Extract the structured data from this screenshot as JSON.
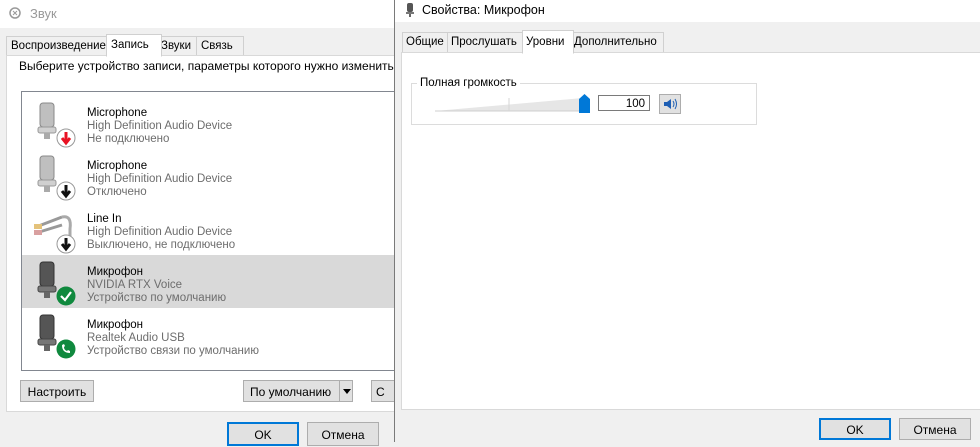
{
  "sound_window": {
    "title": "Звук",
    "tabs": [
      "Воспроизведение",
      "Запись",
      "Звуки",
      "Связь"
    ],
    "active_tab": "Запись",
    "instruction": "Выберите устройство записи, параметры которого нужно изменить:",
    "devices": [
      {
        "name": "Microphone",
        "driver": "High Definition Audio Device",
        "status": "Не подключено",
        "badge": "arrow-down-red-icon"
      },
      {
        "name": "Microphone",
        "driver": "High Definition Audio Device",
        "status": "Отключено",
        "badge": "arrow-down-black-icon"
      },
      {
        "name": "Line In",
        "driver": "High Definition Audio Device",
        "status": "Выключено, не подключено",
        "badge": "arrow-down-black-icon"
      },
      {
        "name": "Микрофон",
        "driver": "NVIDIA RTX Voice",
        "status": "Устройство по умолчанию",
        "badge": "checkmark-green-icon",
        "selected": true
      },
      {
        "name": "Микрофон",
        "driver": "Realtek Audio USB",
        "status": "Устройство связи по умолчанию",
        "badge": "phone-green-icon"
      }
    ],
    "buttons": {
      "configure": "Настроить",
      "set_default": "По умолчанию",
      "properties_partial": "С",
      "ok": "OK",
      "cancel": "Отмена"
    }
  },
  "props_window": {
    "title": "Свойства: Микрофон",
    "tabs": [
      "Общие",
      "Прослушать",
      "Уровни",
      "Дополнительно"
    ],
    "active_tab": "Уровни",
    "levels": {
      "group_label": "Полная громкость",
      "volume_value": "100",
      "volume_fraction": 1.0,
      "mute_icon": "speaker-icon"
    },
    "buttons": {
      "ok": "OK",
      "cancel": "Отмена"
    }
  },
  "colors": {
    "accent": "#0078d7",
    "selection": "#d9d9d9",
    "error_red": "#e81123",
    "ok_green": "#10893e"
  }
}
